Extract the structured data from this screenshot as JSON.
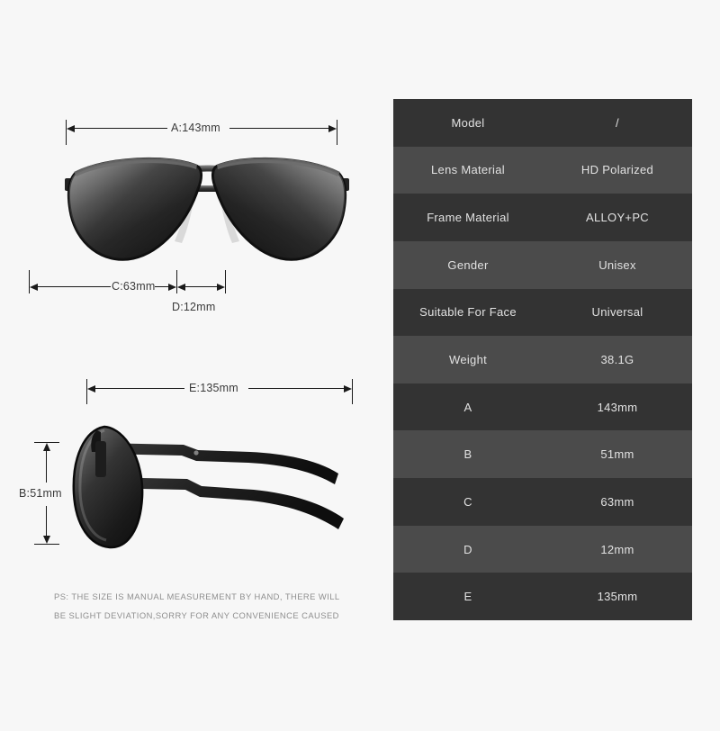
{
  "background_color": "#f7f7f7",
  "dimensions": {
    "a": {
      "label": "A:143mm",
      "value": "143mm",
      "code": "A"
    },
    "b": {
      "label": "B:51mm",
      "value": "51mm",
      "code": "B"
    },
    "c": {
      "label": "C:63mm",
      "value": "63mm",
      "code": "C"
    },
    "d": {
      "label": "D:12mm",
      "value": "12mm",
      "code": "D"
    },
    "e": {
      "label": "E:135mm",
      "value": "135mm",
      "code": "E"
    }
  },
  "disclaimer": {
    "line1": "PS: THE SIZE IS MANUAL MEASUREMENT BY HAND, THERE WILL",
    "line2": "BE SLIGHT DEVIATION,SORRY FOR ANY CONVENIENCE CAUSED"
  },
  "spec_table": {
    "row_color_odd": "#333333",
    "row_color_even": "#4b4b4b",
    "text_color": "#e2e2e2",
    "rows": [
      {
        "key": "Model",
        "value": "/"
      },
      {
        "key": "Lens Material",
        "value": "HD Polarized"
      },
      {
        "key": "Frame Material",
        "value": "ALLOY+PC"
      },
      {
        "key": "Gender",
        "value": "Unisex"
      },
      {
        "key": "Suitable For Face",
        "value": "Universal"
      },
      {
        "key": "Weight",
        "value": "38.1G"
      },
      {
        "key": "A",
        "value": "143mm"
      },
      {
        "key": "B",
        "value": "51mm"
      },
      {
        "key": "C",
        "value": "63mm"
      },
      {
        "key": "D",
        "value": "12mm"
      },
      {
        "key": "E",
        "value": "135mm"
      }
    ]
  },
  "product": {
    "front_view_name": "aviator-sunglasses-front-view",
    "side_view_name": "aviator-sunglasses-side-view",
    "frame_color": "#1c1c1c",
    "lens_color": "#2b2b2b"
  }
}
